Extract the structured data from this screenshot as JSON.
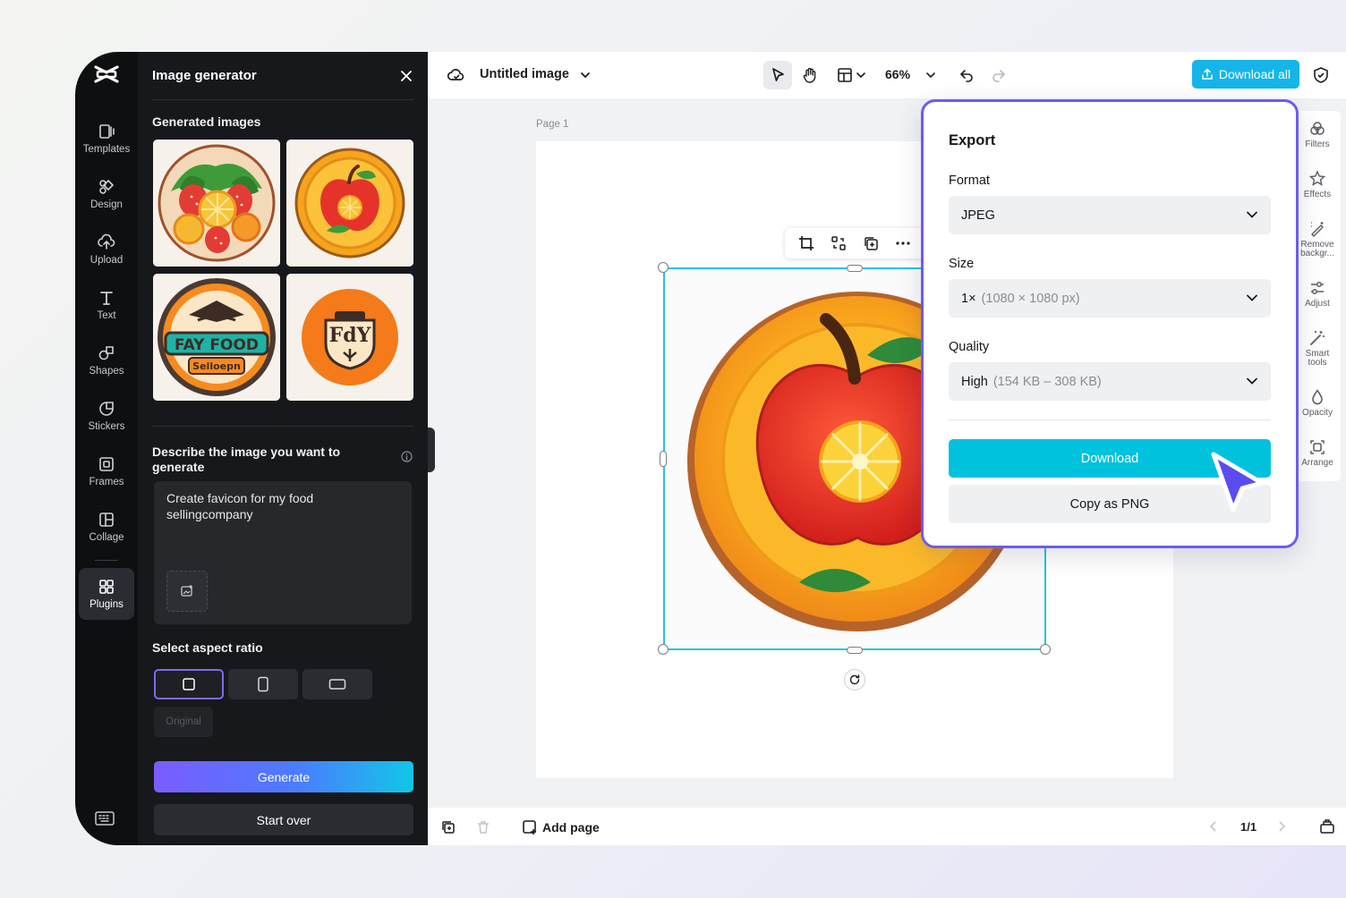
{
  "rail": {
    "items": [
      {
        "label": "Templates",
        "icon": "templates-icon"
      },
      {
        "label": "Design",
        "icon": "design-icon"
      },
      {
        "label": "Upload",
        "icon": "upload-icon"
      },
      {
        "label": "Text",
        "icon": "text-icon"
      },
      {
        "label": "Shapes",
        "icon": "shapes-icon"
      },
      {
        "label": "Stickers",
        "icon": "stickers-icon"
      },
      {
        "label": "Frames",
        "icon": "frames-icon"
      },
      {
        "label": "Collage",
        "icon": "collage-icon"
      },
      {
        "label": "Plugins",
        "icon": "plugins-icon"
      }
    ],
    "active": "Plugins"
  },
  "panel": {
    "title": "Image generator",
    "generated_label": "Generated images",
    "thumbs": [
      {
        "alt": "fruit-plate-icon"
      },
      {
        "alt": "apple-coin-icon"
      },
      {
        "alt": "fay-food-badge",
        "text_top": "FAY FOOD",
        "text_bottom": "Selloepn"
      },
      {
        "alt": "fay-logo-circle",
        "text": "FdY"
      }
    ],
    "describe_label": "Describe the image you want to generate",
    "prompt_value": "Create favicon for my food sellingcompany",
    "aspect_label": "Select aspect ratio",
    "aspect_original": "Original",
    "generate_label": "Generate",
    "start_over_label": "Start over"
  },
  "topbar": {
    "title": "Untitled image",
    "zoom": "66%",
    "download_all_label": "Download all"
  },
  "canvas": {
    "page_label": "Page 1"
  },
  "right_rail": [
    {
      "label": "Filters"
    },
    {
      "label": "Effects"
    },
    {
      "label": "Remove backgr..."
    },
    {
      "label": "Adjust"
    },
    {
      "label": "Smart tools"
    },
    {
      "label": "Opacity"
    },
    {
      "label": "Arrange"
    }
  ],
  "bottombar": {
    "add_page_label": "Add page",
    "pager": "1/1"
  },
  "export": {
    "title": "Export",
    "format_label": "Format",
    "format_value": "JPEG",
    "size_label": "Size",
    "size_value": "1×",
    "size_detail": "(1080 × 1080 px)",
    "quality_label": "Quality",
    "quality_value": "High",
    "quality_detail": "(154 KB – 308 KB)",
    "download_label": "Download",
    "copy_label": "Copy as PNG"
  },
  "colors": {
    "accent": "#00c2dc",
    "popup_border": "#6b5cf0",
    "selection": "#23c3e8",
    "download_all": "#15b5ea"
  }
}
